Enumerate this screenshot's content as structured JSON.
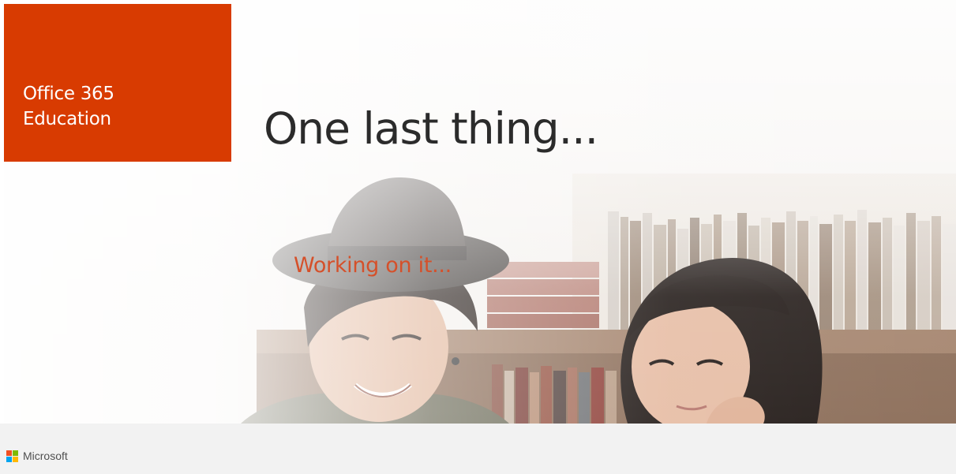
{
  "brand": {
    "product_line1": "Office 365",
    "product_line2": "Education",
    "tile_color": "#d83b01"
  },
  "headline": "One last thing...",
  "status": {
    "text": "Working on it...",
    "color": "#d5502a"
  },
  "footer": {
    "company": "Microsoft",
    "logo_colors": [
      "#f25022",
      "#7fba00",
      "#00a4ef",
      "#ffb900"
    ],
    "logo_icon": "microsoft-four-squares"
  },
  "hero": {
    "subject": "students-in-library-photo"
  }
}
